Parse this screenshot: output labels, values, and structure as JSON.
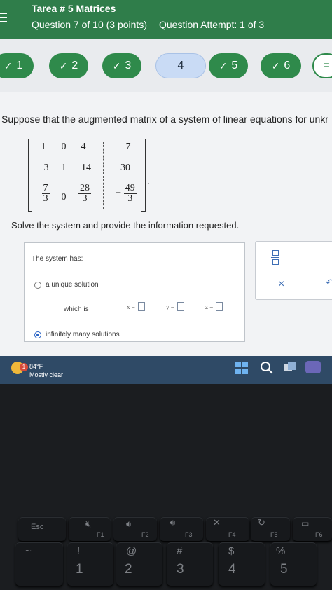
{
  "header": {
    "assignment_title": "Tarea # 5 Matrices",
    "question_position": "Question 7 of 10 (3 points)",
    "attempt": "Question Attempt: 1 of 3"
  },
  "question_nav": [
    {
      "label": "1",
      "status": "completed"
    },
    {
      "label": "2",
      "status": "completed"
    },
    {
      "label": "3",
      "status": "completed"
    },
    {
      "label": "4",
      "status": "current"
    },
    {
      "label": "5",
      "status": "completed"
    },
    {
      "label": "6",
      "status": "completed"
    },
    {
      "label": "=",
      "status": "more"
    }
  ],
  "question": {
    "prompt": "Suppose that the augmented matrix of a system of linear equations for unkr",
    "matrix": {
      "row1": [
        "1",
        "0",
        "4",
        "−7"
      ],
      "row2": [
        "−3",
        "1",
        "−14",
        "30"
      ],
      "row3_col1": {
        "num": "7",
        "den": "3"
      },
      "row3_col2": "0",
      "row3_col3": {
        "num": "28",
        "den": "3"
      },
      "row3_col4": {
        "sign": "−",
        "num": "49",
        "den": "3"
      },
      "end_punct": "."
    },
    "instruction": "Solve the system and provide the information requested."
  },
  "answer": {
    "label": "The system has:",
    "options": [
      {
        "label": "a unique solution",
        "selected": false
      },
      {
        "label": "infinitely many solutions",
        "selected": true
      }
    ],
    "which_is": "which is",
    "vars": [
      "x =",
      "y =",
      "z ="
    ]
  },
  "tools": {
    "clear": "×",
    "undo": "↶"
  },
  "taskbar": {
    "temperature": "84°F",
    "condition": "Mostly clear",
    "badge": "1"
  },
  "keyboard": {
    "fn_row": [
      {
        "label": "Esc"
      },
      {
        "label": "F1",
        "icon": "mute-icon"
      },
      {
        "label": "F2",
        "icon": "volume-down-icon"
      },
      {
        "label": "F3",
        "icon": "volume-up-icon"
      },
      {
        "label": "F4",
        "icon": "mic-mute-icon"
      },
      {
        "label": "F5",
        "icon": "refresh-icon"
      },
      {
        "label": "F6",
        "icon": "screen-icon"
      }
    ],
    "num_row": [
      {
        "top": "~",
        "bottom": ""
      },
      {
        "top": "!",
        "bottom": "1"
      },
      {
        "top": "@",
        "bottom": "2"
      },
      {
        "top": "#",
        "bottom": "3"
      },
      {
        "top": "$",
        "bottom": "4"
      },
      {
        "top": "%",
        "bottom": "5"
      }
    ]
  }
}
